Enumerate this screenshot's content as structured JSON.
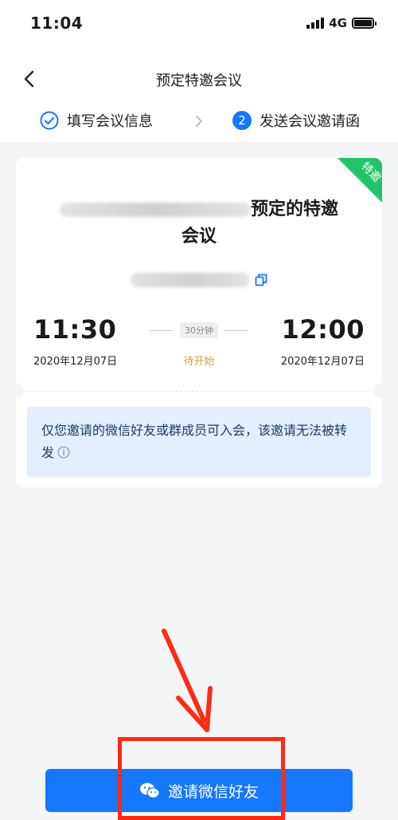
{
  "status_bar": {
    "time": "11:04",
    "network": "4G"
  },
  "nav": {
    "title": "预定特邀会议"
  },
  "steps": [
    {
      "label": "填写会议信息"
    },
    {
      "number": "2",
      "label": "发送会议邀请函"
    }
  ],
  "card": {
    "badge": "特邀",
    "title_suffix": "预定的特邀",
    "title_line2": "会议",
    "start_time": "11:30",
    "start_date": "2020年12月07日",
    "end_time": "12:00",
    "end_date": "2020年12月07日",
    "duration": "30分钟",
    "status": "待开始",
    "notice": "仅您邀请的微信好友或群成员可入会，该邀请无法被转发"
  },
  "invite_button": {
    "label": "邀请微信好友"
  },
  "colors": {
    "primary": "#1677ff",
    "badge_green": "#22c46a",
    "status_orange": "#e39b36",
    "annotation_red": "#ff2a12"
  }
}
